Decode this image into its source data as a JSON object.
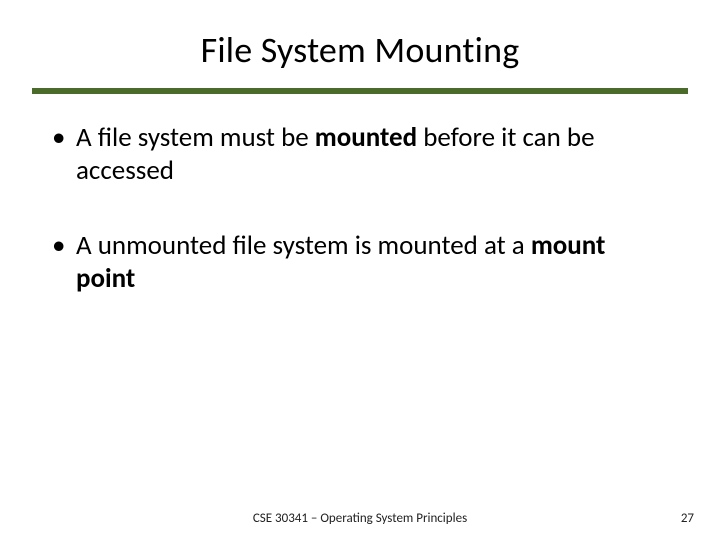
{
  "title": "File System Mounting",
  "bullets": [
    {
      "pre": "A file system must be ",
      "bold": "mounted",
      "post": " before it can be accessed"
    },
    {
      "pre": "A unmounted file system is mounted at a ",
      "bold": "mount point",
      "post": ""
    }
  ],
  "footer": {
    "course": "CSE 30341 – Operating System Principles",
    "page": "27"
  }
}
